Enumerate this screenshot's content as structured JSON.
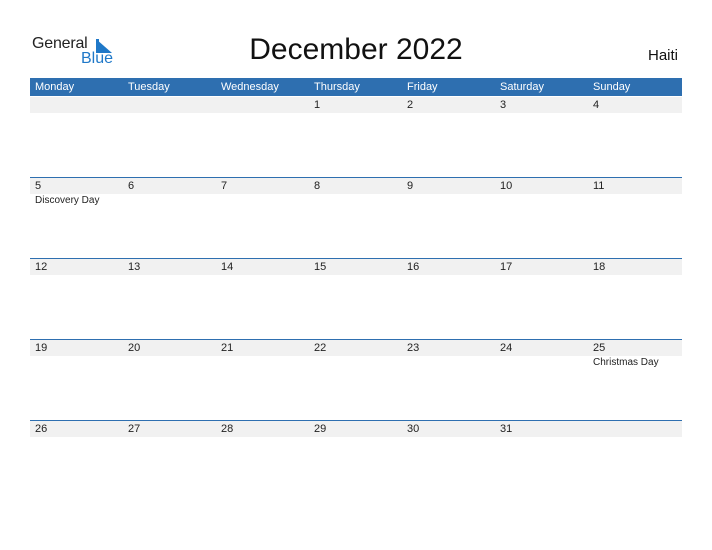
{
  "logo": {
    "word1": "General",
    "word2": "Blue"
  },
  "title": "December 2022",
  "country": "Haiti",
  "colors": {
    "accent": "#2e6fb0",
    "logo_blue": "#1f78c8",
    "row_bg": "#f1f1f1"
  },
  "weekdays": [
    "Monday",
    "Tuesday",
    "Wednesday",
    "Thursday",
    "Friday",
    "Saturday",
    "Sunday"
  ],
  "weeks": [
    {
      "days": [
        "",
        "",
        "",
        "1",
        "2",
        "3",
        "4"
      ],
      "holidays": [
        "",
        "",
        "",
        "",
        "",
        "",
        ""
      ]
    },
    {
      "days": [
        "5",
        "6",
        "7",
        "8",
        "9",
        "10",
        "11"
      ],
      "holidays": [
        "Discovery Day",
        "",
        "",
        "",
        "",
        "",
        ""
      ]
    },
    {
      "days": [
        "12",
        "13",
        "14",
        "15",
        "16",
        "17",
        "18"
      ],
      "holidays": [
        "",
        "",
        "",
        "",
        "",
        "",
        ""
      ]
    },
    {
      "days": [
        "19",
        "20",
        "21",
        "22",
        "23",
        "24",
        "25"
      ],
      "holidays": [
        "",
        "",
        "",
        "",
        "",
        "",
        "Christmas Day"
      ]
    },
    {
      "days": [
        "26",
        "27",
        "28",
        "29",
        "30",
        "31",
        ""
      ],
      "holidays": [
        "",
        "",
        "",
        "",
        "",
        "",
        ""
      ]
    }
  ]
}
